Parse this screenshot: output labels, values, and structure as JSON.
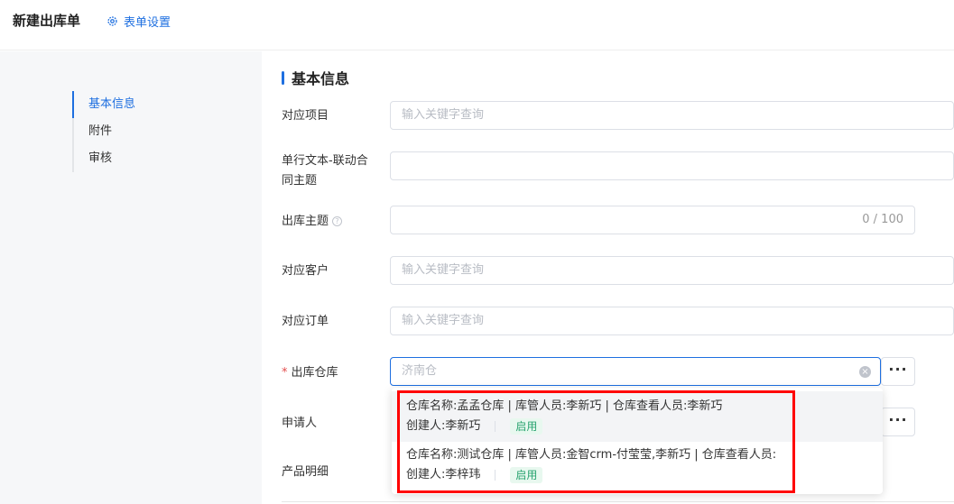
{
  "header": {
    "title": "新建出库单",
    "settings_label": "表单设置"
  },
  "anchor_nav": {
    "items": [
      "基本信息",
      "附件",
      "审核"
    ],
    "active_index": 0
  },
  "section": {
    "title": "基本信息"
  },
  "fields": {
    "project": {
      "label": "对应项目",
      "placeholder": "输入关键字查询"
    },
    "linked_text": {
      "label_line1": "单行文本-联动合",
      "label_line2": "同主题",
      "value": ""
    },
    "subject": {
      "label": "出库主题",
      "count": "0 / 100"
    },
    "customer": {
      "label": "对应客户",
      "placeholder": "输入关键字查询"
    },
    "order": {
      "label": "对应订单",
      "placeholder": "输入关键字查询"
    },
    "warehouse": {
      "label": "出库仓库",
      "required_mark": "*",
      "value": "济南仓"
    },
    "applicant": {
      "label": "申请人"
    },
    "product_detail": {
      "label": "产品明细"
    }
  },
  "dots_label": "···",
  "dropdown": {
    "options": [
      {
        "line1": "仓库名称:孟孟仓库 | 库管人员:李新巧 | 仓库查看人员:李新巧",
        "creator": "创建人:李新巧",
        "status": "启用"
      },
      {
        "line1": "仓库名称:测试仓库 | 库管人员:金智crm-付莹莹,李新巧 | 仓库查看人员:",
        "creator": "创建人:李梓玮",
        "status": "启用"
      }
    ]
  }
}
